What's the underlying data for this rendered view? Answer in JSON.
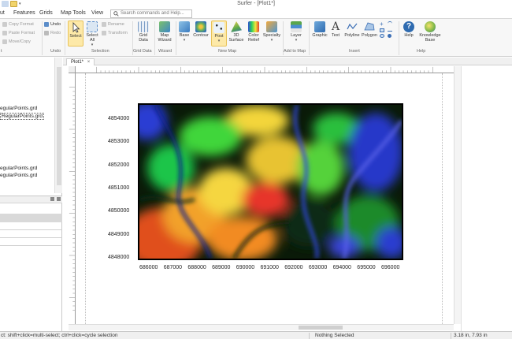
{
  "window": {
    "title": "Surfer - [Plot1*]"
  },
  "menu": {
    "tabs": [
      "ut",
      "Features",
      "Grids",
      "Map Tools",
      "View"
    ],
    "search_placeholder": "Search commands and Help..."
  },
  "ribbon": {
    "clipboard": {
      "copy_format": "Copy Format",
      "paste_format": "Paste Format",
      "move_copy": "Move/Copy",
      "label": "t"
    },
    "undo": {
      "undo": "Undo",
      "redo": "Redo",
      "label": "Undo"
    },
    "selection": {
      "select": "Select",
      "select_all": "Select All",
      "rename": "Rename",
      "transform": "Transform",
      "label": "Selection"
    },
    "grid_data": {
      "grid_data": "Grid Data",
      "label": "Grid Data"
    },
    "wizard": {
      "map_wizard": "Map Wizard",
      "label": "Wizard"
    },
    "new_map": {
      "base": "Base",
      "contour": "Contour",
      "post": "Post",
      "surface3d": "3D Surface",
      "color_relief": "Color Relief",
      "specialty": "Specialty",
      "label": "New Map"
    },
    "add_to_map": {
      "layer": "Layer",
      "label": "Add to Map"
    },
    "insert": {
      "graphic": "Graphic",
      "text": "Text",
      "polyline": "Polyline",
      "polygon": "Polygon",
      "label": "Insert"
    },
    "help": {
      "help": "Help",
      "knowledge_base": "Knowledge Base",
      "label": "Help"
    }
  },
  "left_panel": {
    "items": [
      "egularPoints.grd",
      "RegularPoints.grd",
      "egularPoints.grd",
      "egularPoints.grd"
    ],
    "selected_index": 1
  },
  "document": {
    "tab_label": "Plot1*"
  },
  "map": {
    "y_labels": [
      "4854000",
      "4853000",
      "4852000",
      "4851000",
      "4850000",
      "4849000",
      "4848000"
    ],
    "x_labels": [
      "686000",
      "687000",
      "688000",
      "689000",
      "690000",
      "691000",
      "692000",
      "693000",
      "694000",
      "695000",
      "696000"
    ]
  },
  "status": {
    "hint": "ct: shift+click=multi-select; ctrl+click=cycle selection",
    "selection": "Nothing Selected",
    "cursor": "3.18 in, 7.93 in"
  },
  "colors": {
    "ribbon_bg": "#f7f7f7",
    "selected_button": "#fde9a8"
  }
}
